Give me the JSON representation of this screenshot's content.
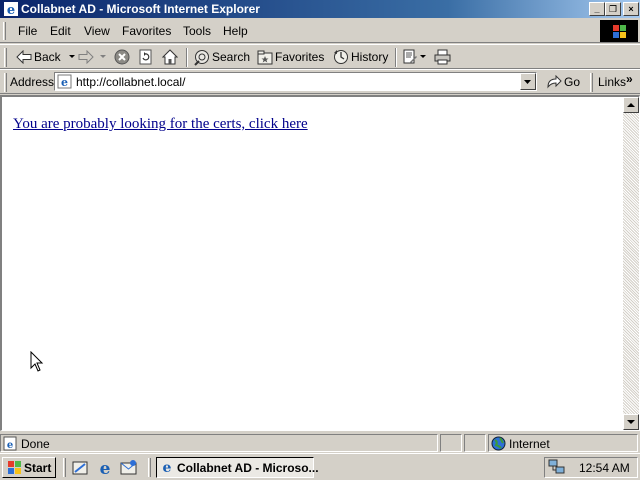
{
  "window": {
    "title": "Collabnet AD - Microsoft Internet Explorer",
    "controls": {
      "minimize": "_",
      "restore": "❐",
      "close": "×"
    }
  },
  "menu": [
    "File",
    "Edit",
    "View",
    "Favorites",
    "Tools",
    "Help"
  ],
  "toolbar": {
    "back_label": "Back",
    "search_label": "Search",
    "favorites_label": "Favorites",
    "history_label": "History",
    "icons": [
      "back-icon",
      "forward-icon",
      "stop-icon",
      "refresh-icon",
      "home-icon",
      "search-icon",
      "favorites-icon",
      "history-icon",
      "edit-icon",
      "print-icon"
    ]
  },
  "address": {
    "label": "Address",
    "value": "http://collabnet.local/",
    "go_label": "Go",
    "links_label": "Links",
    "links_chevron": "»"
  },
  "page": {
    "link_text": "You are probably looking for the certs, click here"
  },
  "status": {
    "text": "Done",
    "zone": "Internet"
  },
  "taskbar": {
    "start_label": "Start",
    "task_label": "Collabnet AD - Microso...",
    "clock": "12:54 AM",
    "quick_launch": [
      "show-desktop-icon",
      "ie-icon",
      "outlook-icon"
    ]
  },
  "colors": {
    "titlebar_start": "#0a246a",
    "titlebar_end": "#a6caf0",
    "link": "#00008b",
    "chrome": "#d4d0c8"
  }
}
